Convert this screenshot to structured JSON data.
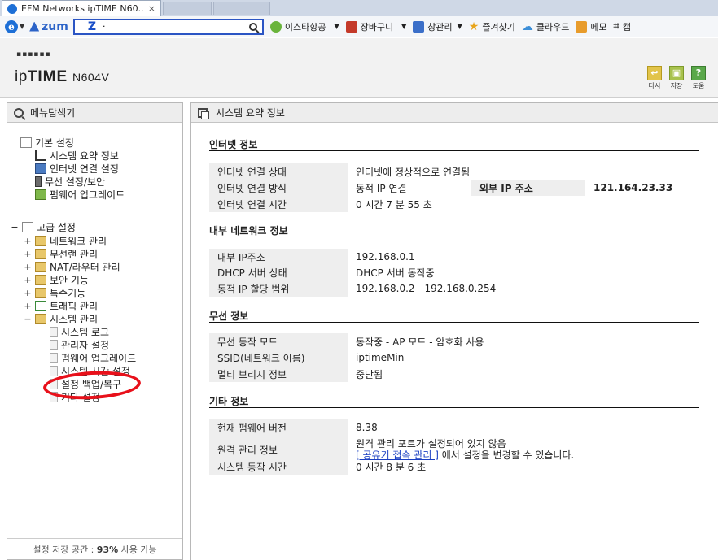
{
  "browser": {
    "tab_title": "EFM Networks ipTIME N60...",
    "tab_close": "×",
    "search_logo": "zum",
    "search_z": "Z",
    "search_value": "·",
    "toolbar_items": [
      {
        "icon": "eastar-icon",
        "label": "이스타항공",
        "color": "#6ab43c"
      },
      {
        "icon": "cart-icon",
        "label": "장바구니",
        "color": "#c43a2a"
      },
      {
        "icon": "window-icon",
        "label": "창관리",
        "color": "#3b6fc9"
      },
      {
        "icon": "star-icon",
        "label": "즐겨찾기",
        "color": "#e8a51c"
      },
      {
        "icon": "cloud-icon",
        "label": "클라우드",
        "color": "#3b8ed8"
      },
      {
        "icon": "memo-icon",
        "label": "메모",
        "color": "#e89c2c"
      },
      {
        "icon": "crop-icon",
        "label": "캡",
        "color": "#444444"
      }
    ]
  },
  "header": {
    "dots": "▪▪▪▪▪▪",
    "brand": "ipTIME",
    "brand_prefix": "ip",
    "brand_strong": "TIME",
    "model": "N604V",
    "buttons": [
      {
        "icon": "back-icon",
        "label": "다시",
        "glyph": "↩"
      },
      {
        "icon": "save-icon",
        "label": "저장",
        "glyph": "▣"
      },
      {
        "icon": "help-icon",
        "label": "도움",
        "glyph": "?"
      }
    ]
  },
  "menu": {
    "title": "메뉴탐색기",
    "basic": {
      "label": "기본 설정",
      "items": [
        "시스템 요약 정보",
        "인터넷 연결 설정",
        "무선 설정/보안",
        "펌웨어 업그레이드"
      ]
    },
    "advanced": {
      "label": "고급 설정",
      "items": [
        {
          "label": "네트워크 관리",
          "toggle": "+"
        },
        {
          "label": "무선랜 관리",
          "toggle": "+"
        },
        {
          "label": "NAT/라우터 관리",
          "toggle": "+"
        },
        {
          "label": "보안 기능",
          "toggle": "+"
        },
        {
          "label": "특수기능",
          "toggle": "+"
        },
        {
          "label": "트래픽 관리",
          "toggle": "+"
        },
        {
          "label": "시스템 관리",
          "toggle": "−"
        }
      ],
      "system_items": [
        "시스템 로그",
        "관리자 설정",
        "펌웨어 업그레이드",
        "시스템 시간 설정",
        "설정 백업/복구",
        "기타 설정"
      ]
    },
    "collapse_toggle": "−",
    "storage_prefix": "설정 저장 공간 : ",
    "storage_percent": "93%",
    "storage_suffix": " 사용 가능"
  },
  "summary": {
    "title": "시스템 요약 정보",
    "internet": {
      "title": "인터넷 정보",
      "rows": [
        {
          "label": "인터넷 연결 상태",
          "value": "인터넷에 정상적으로 연결됨"
        },
        {
          "label": "인터넷 연결 방식",
          "value": "동적 IP 연결"
        },
        {
          "label": "인터넷 연결 시간",
          "value": "0 시간 7 분 55 초"
        }
      ],
      "external_ip_label": "외부 IP 주소",
      "external_ip_value": "121.164.23.33"
    },
    "lan": {
      "title": "내부 네트워크 정보",
      "rows": [
        {
          "label": "내부 IP주소",
          "value": "192.168.0.1"
        },
        {
          "label": "DHCP 서버 상태",
          "value": "DHCP 서버 동작중"
        },
        {
          "label": "동적 IP 할당 범위",
          "value": "192.168.0.2 -  192.168.0.254"
        }
      ]
    },
    "wireless": {
      "title": "무선 정보",
      "rows": [
        {
          "label": "무선 동작 모드",
          "value": "동작중 - AP 모드 - 암호화 사용"
        },
        {
          "label": "SSID(네트워크 이름)",
          "value": "iptimeMin"
        },
        {
          "label": "멀티 브리지 정보",
          "value": "중단됨"
        }
      ]
    },
    "etc": {
      "title": "기타 정보",
      "firmware_label": "현재 펌웨어 버전",
      "firmware_value": "8.38",
      "remote_label": "원격 관리 정보",
      "remote_line1": "원격 관리 포트가 설정되어 있지 않음",
      "remote_link": "[ 공유기 접속 관리 ]",
      "remote_line2": "에서 설정을 변경할 수 있습니다.",
      "uptime_label": "시스템 동작 시간",
      "uptime_value": "0 시간 8 분 6 초"
    }
  }
}
